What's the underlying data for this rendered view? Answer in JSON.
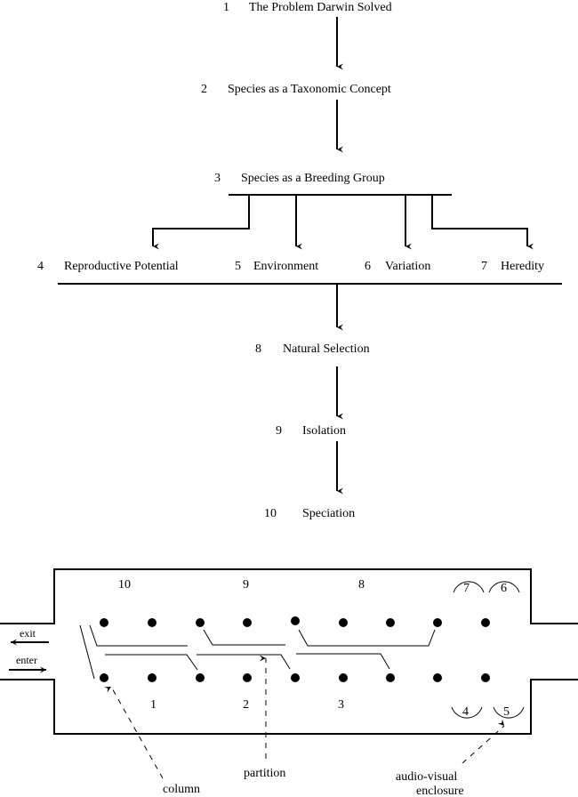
{
  "flowchart": {
    "nodes": [
      {
        "num": "1",
        "label": "The Problem Darwin Solved"
      },
      {
        "num": "2",
        "label": "Species as a Taxonomic Concept"
      },
      {
        "num": "3",
        "label": "Species as a Breeding Group"
      },
      {
        "num": "4",
        "label": "Reproductive Potential"
      },
      {
        "num": "5",
        "label": "Environment"
      },
      {
        "num": "6",
        "label": "Variation"
      },
      {
        "num": "7",
        "label": "Heredity"
      },
      {
        "num": "8",
        "label": "Natural Selection"
      },
      {
        "num": "9",
        "label": "Isolation"
      },
      {
        "num": "10",
        "label": "Speciation"
      }
    ]
  },
  "floorplan": {
    "top_section_numbers": [
      "10",
      "9",
      "8"
    ],
    "bottom_section_numbers": [
      "1",
      "2",
      "3"
    ],
    "enclosures_top": [
      "7",
      "6"
    ],
    "enclosures_bottom": [
      "4",
      "5"
    ],
    "exit_label": "exit",
    "enter_label": "enter",
    "callouts": {
      "column": "column",
      "partition": "partition",
      "audio_visual_line1": "audio-visual",
      "audio_visual_line2": "enclosure"
    }
  }
}
